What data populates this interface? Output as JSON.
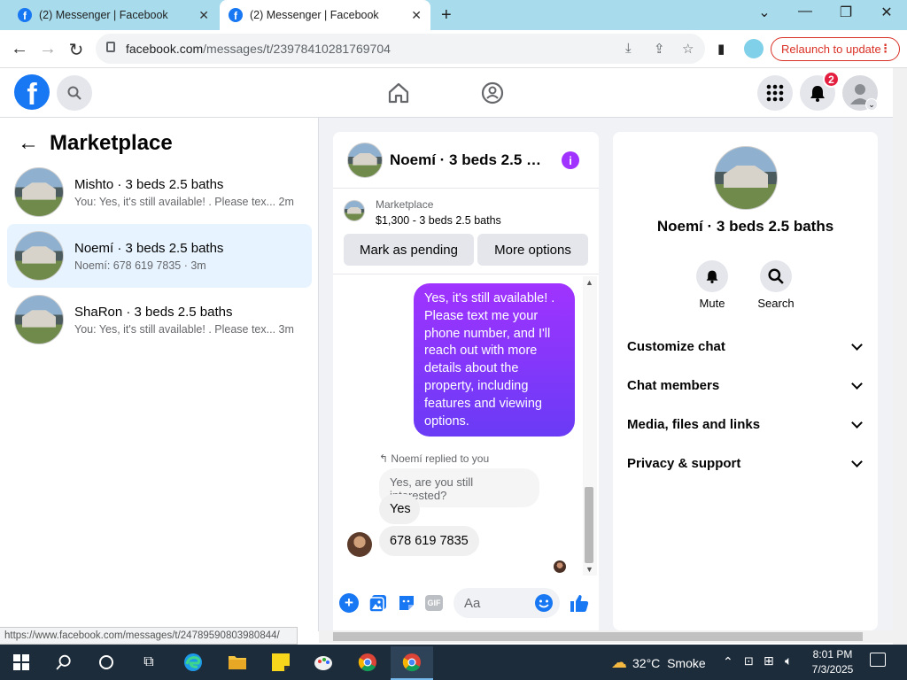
{
  "browser": {
    "tabs": [
      {
        "title": "(2) Messenger | Facebook"
      },
      {
        "title": "(2) Messenger | Facebook"
      }
    ],
    "url_domain": "facebook.com",
    "url_path": "/messages/t/23978410281769704",
    "relaunch_label": "Relaunch to update",
    "status_url": "https://www.facebook.com/messages/t/24789590803980844/"
  },
  "fb_header": {
    "logo_letter": "f",
    "notification_count": "2"
  },
  "left_panel": {
    "title": "Marketplace",
    "conversations": [
      {
        "name": "Mishto · 3 beds 2.5 baths",
        "preview": "You: Yes, it's still available! . Please tex... 2m"
      },
      {
        "name": "Noemí · 3 beds 2.5 baths",
        "preview": "Noemí: 678 619 7835 · 3m"
      },
      {
        "name": "ShaRon · 3 beds 2.5 baths",
        "preview": "You: Yes, it's still available! . Please tex... 3m"
      }
    ]
  },
  "chat": {
    "title": "Noemí · 3 beds 2.5 b...",
    "listing_source": "Marketplace",
    "listing_price": "$1,300 - 3 beds 2.5 baths",
    "mark_pending_label": "Mark as pending",
    "more_options_label": "More options",
    "outgoing_message": "Yes, it's still available! . Please text me your phone number, and I'll reach out with more details about the property, including features and viewing options.",
    "replied_label": "Noemí replied to you",
    "quoted_message": "Yes, are you still interested?",
    "incoming_1": "Yes",
    "incoming_2": "678 619 7835",
    "composer_placeholder": "Aa",
    "gif_label": "GIF"
  },
  "right_panel": {
    "name": "Noemí · 3 beds 2.5 baths",
    "actions": [
      {
        "label": "Mute"
      },
      {
        "label": "Search"
      }
    ],
    "sections": [
      {
        "label": "Customize chat"
      },
      {
        "label": "Chat members"
      },
      {
        "label": "Media, files and links"
      },
      {
        "label": "Privacy & support"
      }
    ]
  },
  "taskbar": {
    "temperature": "32°C",
    "weather": "Smoke",
    "time": "8:01 PM",
    "date": "7/3/2025"
  },
  "colors": {
    "fb_blue": "#1877f2",
    "bubble_purple": "#a033ff",
    "badge_red": "#e41e3f"
  }
}
